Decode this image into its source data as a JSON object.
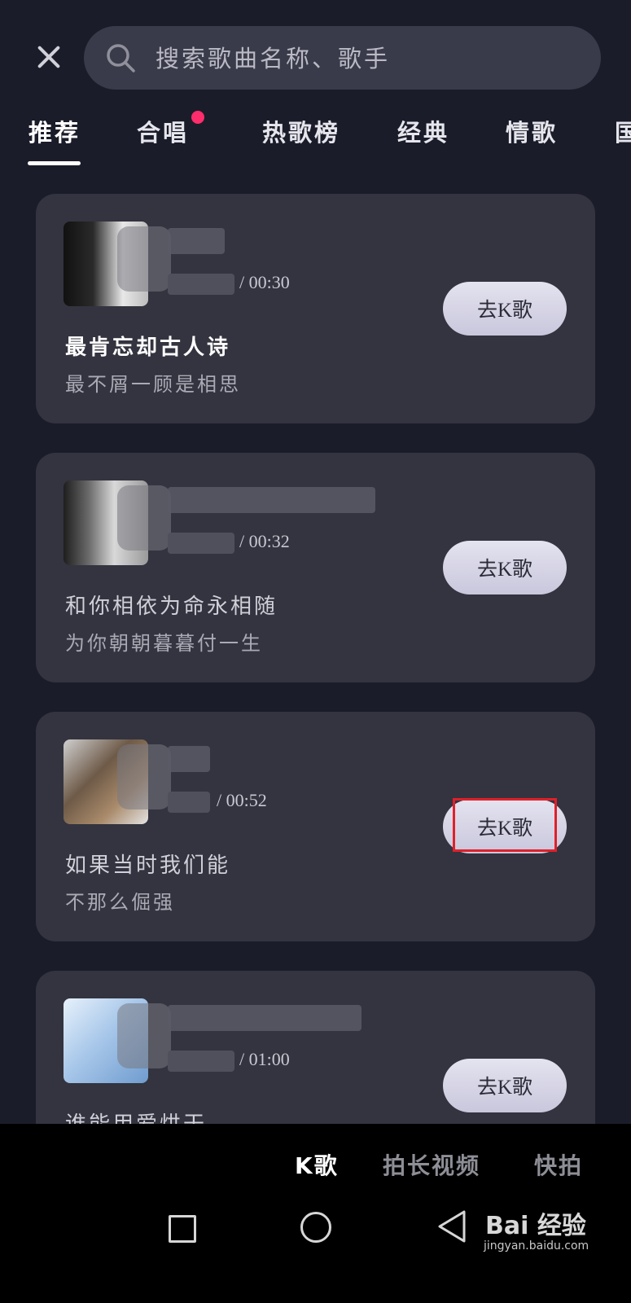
{
  "search": {
    "placeholder": "搜索歌曲名称、歌手"
  },
  "tabs": [
    {
      "label": "推荐"
    },
    {
      "label": "合唱"
    },
    {
      "label": "热歌榜"
    },
    {
      "label": "经典"
    },
    {
      "label": "情歌"
    },
    {
      "label": "国"
    }
  ],
  "cards": [
    {
      "duration": "/ 00:30",
      "line1": "最肯忘却古人诗",
      "line2": "最不屑一顾是相思",
      "button": "去K歌"
    },
    {
      "duration": "/ 00:32",
      "line1": "和你相依为命永相随",
      "line2": "为你朝朝暮暮付一生",
      "button": "去K歌"
    },
    {
      "duration": "/ 00:52",
      "line1": "如果当时我们能",
      "line2": "不那么倔强",
      "button": "去K歌"
    },
    {
      "duration": "/ 01:00",
      "line1": "谁能用爱烘干",
      "line2": "",
      "button": "去K歌"
    }
  ],
  "bottom_nav": [
    {
      "label": "K歌"
    },
    {
      "label": "拍长视频"
    },
    {
      "label": "快拍"
    }
  ],
  "watermark": {
    "brand": "Bai  经验",
    "url": "jingyan.baidu.com"
  },
  "colors": {
    "background": "#1b1c2a",
    "card": "#33343f",
    "accent_dot": "#ff2d6b",
    "highlight": "#e0202a"
  }
}
